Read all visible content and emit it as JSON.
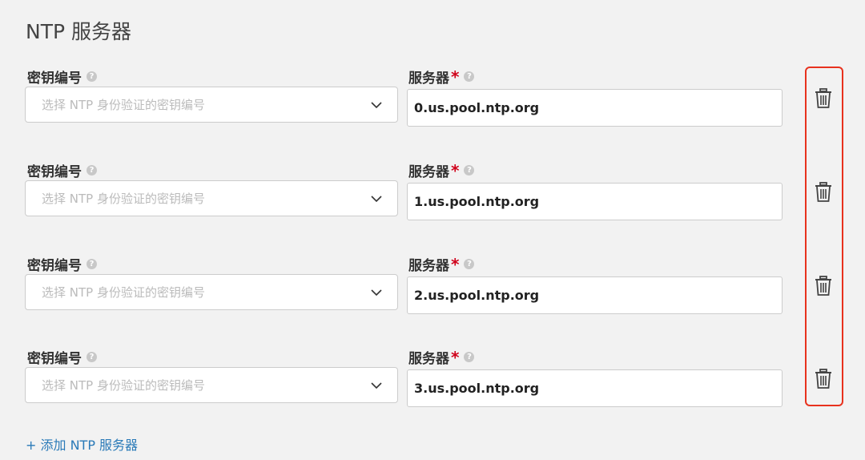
{
  "section": {
    "title": "NTP 服务器"
  },
  "labels": {
    "key_id": "密钥编号",
    "server": "服务器",
    "required_mark": "*",
    "help_glyph": "?"
  },
  "key_select": {
    "placeholder": "选择 NTP 身份验证的密钥编号"
  },
  "rows": [
    {
      "server": "0.us.pool.ntp.org"
    },
    {
      "server": "1.us.pool.ntp.org"
    },
    {
      "server": "2.us.pool.ntp.org"
    },
    {
      "server": "3.us.pool.ntp.org"
    }
  ],
  "add_server": {
    "label": "+ 添加 NTP 服务器"
  },
  "colors": {
    "background": "#f2f2f2",
    "link": "#2a7ab8",
    "required": "#d0021b",
    "highlight_border": "#e8321e"
  }
}
